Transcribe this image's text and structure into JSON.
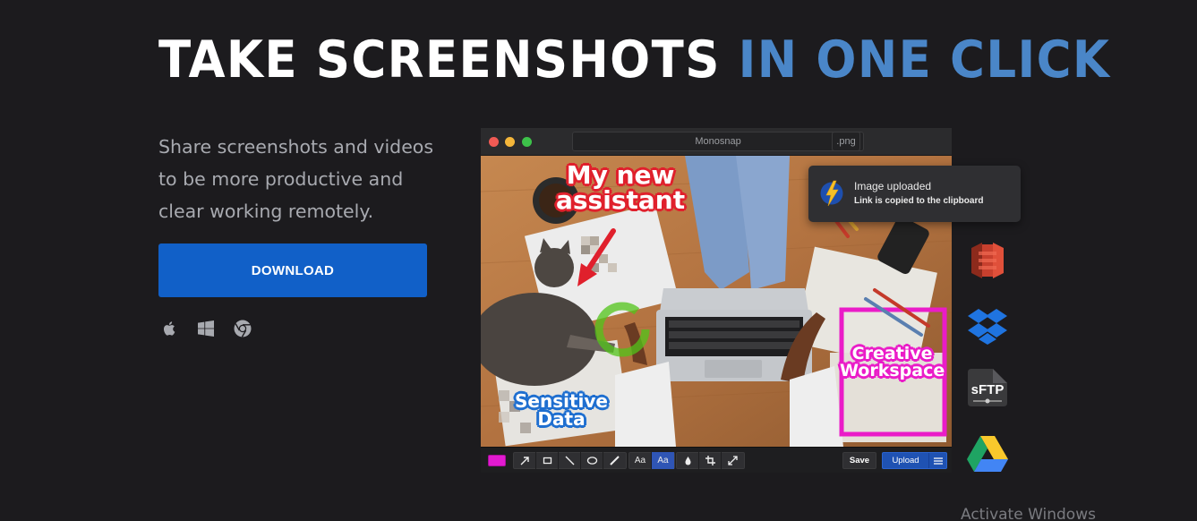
{
  "hero": {
    "headline_white": "TAKE SCREENSHOTS ",
    "headline_blue": "IN ONE CLICK",
    "tagline": "Share screenshots and videos to be more productive and clear working remotely.",
    "download_label": "DOWNLOAD",
    "platform_icons": [
      "apple-icon",
      "windows-icon",
      "chrome-icon"
    ]
  },
  "app_window": {
    "title": "Monosnap",
    "extension": ".png",
    "annotations": {
      "red": [
        "My new",
        "assistant"
      ],
      "blue": [
        "Sensitive",
        "Data"
      ],
      "pink": [
        "Creative",
        "Workspace"
      ]
    },
    "toolbar": {
      "tools": [
        "arrow",
        "rectangle",
        "line",
        "ellipse",
        "pen"
      ],
      "text_tools": [
        "Aa",
        "Aa"
      ],
      "extra_tools": [
        "blur",
        "crop",
        "resize"
      ],
      "save_label": "Save",
      "upload_label": "Upload"
    }
  },
  "toast": {
    "title": "Image uploaded",
    "subtitle": "Link is copied to the clipboard"
  },
  "cloud_services": [
    "amazon-s3",
    "dropbox",
    "sftp",
    "google-drive"
  ],
  "sftp_label": "sFTP",
  "watermark": "Activate Windows",
  "colors": {
    "background": "#1c1b1e",
    "accent_blue": "#4a86c8",
    "button_blue": "#1160c8",
    "annotation_red": "#e0202c",
    "annotation_pink": "#ea1cc8"
  }
}
